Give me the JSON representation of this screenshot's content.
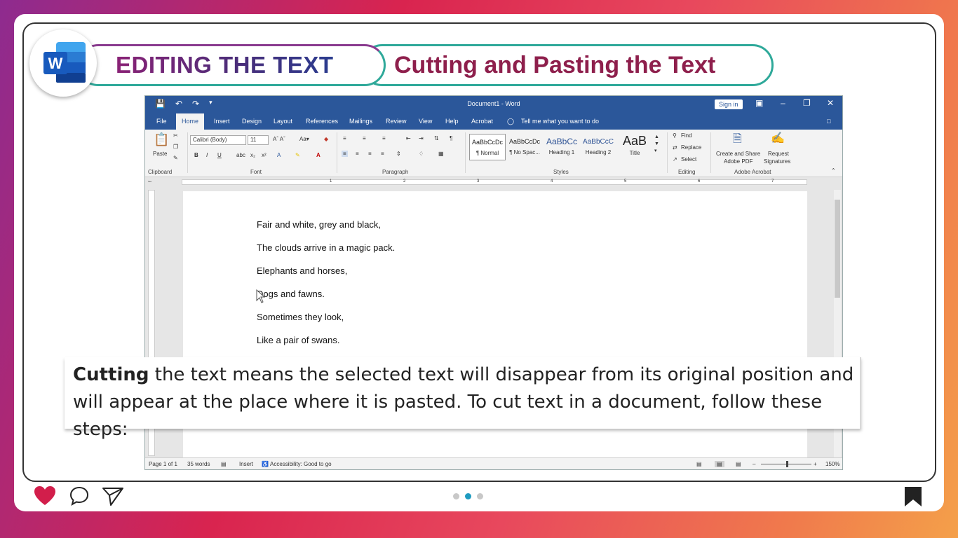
{
  "header": {
    "section_title": "EDITING THE TEXT",
    "topic_title": "Cutting and Pasting the Text",
    "logo_letter": "W"
  },
  "word": {
    "qat_icons": [
      "save-icon",
      "undo-icon",
      "redo-icon",
      "customize-icon"
    ],
    "doc_title": "Document1  -  Word",
    "sign_in": "Sign in",
    "tabs": [
      "File",
      "Home",
      "Insert",
      "Design",
      "Layout",
      "References",
      "Mailings",
      "Review",
      "View",
      "Help",
      "Acrobat"
    ],
    "tell_me": "Tell me what you want to do",
    "ribbon": {
      "paste": "Paste",
      "font_name": "Calibri (Body)",
      "font_size": "11",
      "styles": [
        {
          "sample": "AaBbCcDc",
          "name": "¶ Normal"
        },
        {
          "sample": "AaBbCcDc",
          "name": "¶ No Spac..."
        },
        {
          "sample": "AaBbCc",
          "name": "Heading 1"
        },
        {
          "sample": "AaBbCcC",
          "name": "Heading 2"
        },
        {
          "sample": "AaB",
          "name": "Title"
        }
      ],
      "find": "Find",
      "replace": "Replace",
      "select": "Select",
      "create_share": "Create and Share",
      "adobe_pdf": "Adobe PDF",
      "request": "Request",
      "signatures": "Signatures",
      "groups": [
        "Clipboard",
        "Font",
        "Paragraph",
        "Styles",
        "Editing",
        "Adobe Acrobat"
      ]
    },
    "ruler_numbers": [
      "1",
      "2",
      "3",
      "4",
      "5",
      "6",
      "7"
    ],
    "document_lines": [
      "Fair and white, grey and black,",
      "The clouds arrive in a magic pack.",
      "Elephants and horses,",
      "Dogs and fawns.",
      "Sometimes they look,",
      "Like a pair of swans."
    ],
    "status": {
      "page": "Page 1 of 1",
      "words": "35 words",
      "mode": "Insert",
      "accessibility": "Accessibility: Good to go",
      "zoom": "150%"
    }
  },
  "caption": {
    "bold": "Cutting",
    "rest": " the text means the selected text will disappear from its original position and will appear at the place where it is pasted. To cut text in a document, follow these steps:"
  },
  "colors": {
    "word_blue": "#2b579a",
    "teal": "#2fa99a",
    "maroon": "#8e1f4c",
    "dot_active": "#1e9bc0",
    "heart": "#d21e4b"
  }
}
